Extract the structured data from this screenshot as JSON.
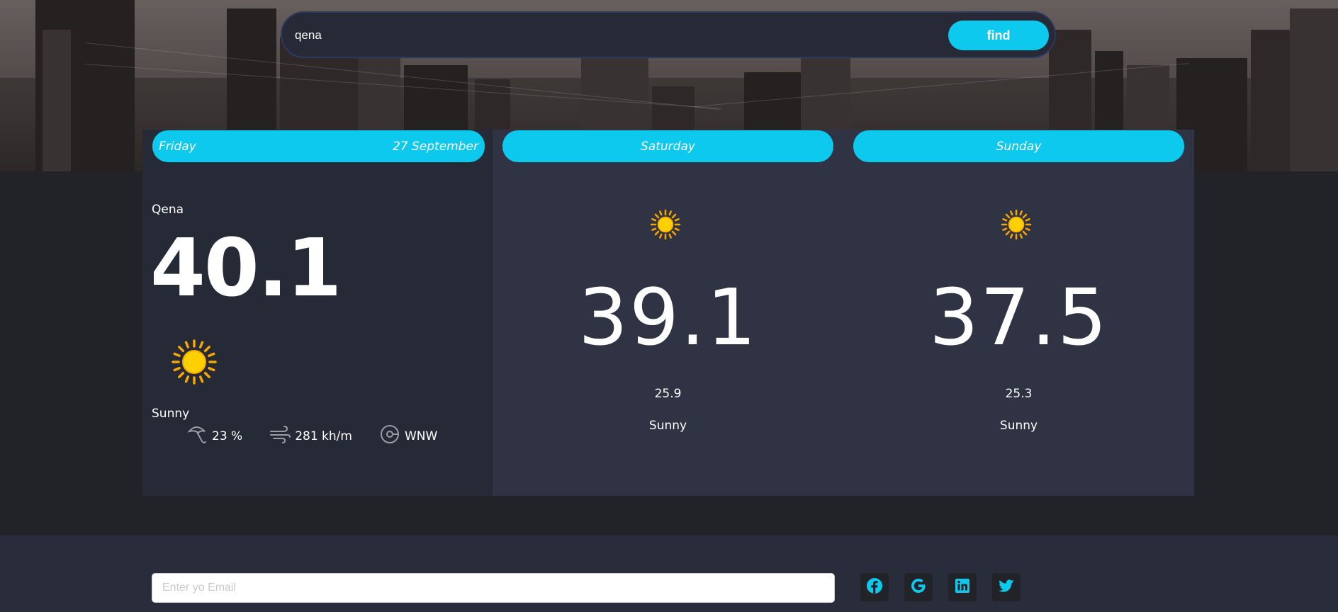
{
  "search": {
    "value": "qena",
    "button_label": "find"
  },
  "today": {
    "day": "Friday",
    "date": "27 September",
    "city": "Qena",
    "temperature": "40.1",
    "icon": "sun-icon",
    "condition": "Sunny",
    "humidity": "23 %",
    "wind_speed": "281 kh/m",
    "wind_direction": "WNW"
  },
  "forecast": [
    {
      "day": "Saturday",
      "icon": "sun-icon",
      "max_temp": "39.1",
      "min_temp": "25.9",
      "condition": "Sunny"
    },
    {
      "day": "Sunday",
      "icon": "sun-icon",
      "max_temp": "37.5",
      "min_temp": "25.3",
      "condition": "Sunny"
    }
  ],
  "footer": {
    "email_placeholder": "Enter yo Email",
    "social": [
      "facebook-icon",
      "google-icon",
      "linkedin-icon",
      "twitter-icon"
    ]
  },
  "colors": {
    "accent": "#0dc9ee",
    "page_bg": "#212329",
    "card_today": "#262936",
    "card_other": "#303343",
    "footer_bg": "#292c3b"
  }
}
